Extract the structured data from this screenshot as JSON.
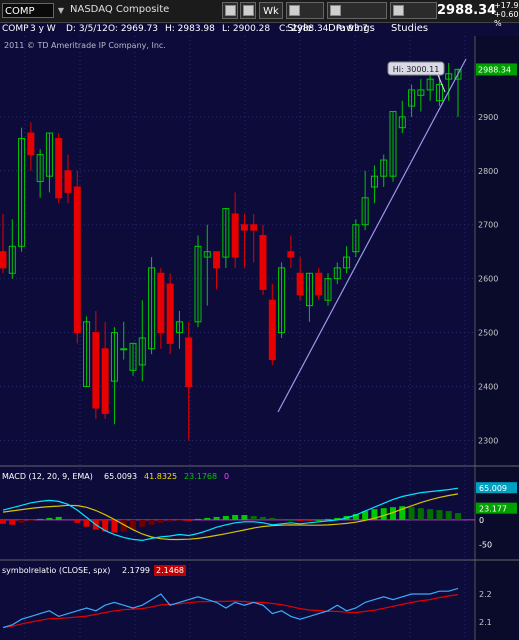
{
  "toolbar": {
    "symbol": "COMP",
    "symbol_name": "NASDAQ Composite",
    "period_button": "Wk",
    "style_button": "Style",
    "drawings_button": "Drawings",
    "studies_button": "Studies",
    "last_price": "2988.34",
    "net_change": "+17.92",
    "pct_change": "+0.60 %"
  },
  "info": {
    "period": "3 y W",
    "date": "D: 3/5/12",
    "open": "O: 2969.73",
    "high": "H: 2983.98",
    "low": "L: 2900.28",
    "close": "C: 2988.34",
    "range": "R: 93.7"
  },
  "copyright": "2011 © TD Ameritrade IP Company, Inc.",
  "hi_label": "Hi: 3000.11",
  "price_flag": "2988.34",
  "colors": {
    "bull": "#00c800",
    "bear": "#e60000",
    "bg": "#0d0b3a",
    "macd_line": "#00e6ff",
    "macd_signal": "#d4c400",
    "ratio_line": "#3aaaff",
    "ratio_ma": "#e60000"
  },
  "price_axis": [
    "2900",
    "2800",
    "2700",
    "2600",
    "2500",
    "2400",
    "2300"
  ],
  "chart_data": [
    {
      "type": "candlestick",
      "ylim": [
        2260,
        3050
      ],
      "candles": [
        {
          "o": 2650,
          "h": 2720,
          "l": 2610,
          "c": 2620
        },
        {
          "o": 2610,
          "h": 2710,
          "l": 2600,
          "c": 2660
        },
        {
          "o": 2660,
          "h": 2880,
          "l": 2650,
          "c": 2860
        },
        {
          "o": 2870,
          "h": 2890,
          "l": 2800,
          "c": 2830
        },
        {
          "o": 2780,
          "h": 2840,
          "l": 2750,
          "c": 2830
        },
        {
          "o": 2790,
          "h": 2870,
          "l": 2760,
          "c": 2870
        },
        {
          "o": 2860,
          "h": 2870,
          "l": 2740,
          "c": 2750
        },
        {
          "o": 2800,
          "h": 2830,
          "l": 2740,
          "c": 2760
        },
        {
          "o": 2770,
          "h": 2800,
          "l": 2480,
          "c": 2500
        },
        {
          "o": 2400,
          "h": 2530,
          "l": 2400,
          "c": 2520
        },
        {
          "o": 2500,
          "h": 2540,
          "l": 2340,
          "c": 2360
        },
        {
          "o": 2470,
          "h": 2520,
          "l": 2340,
          "c": 2350
        },
        {
          "o": 2410,
          "h": 2510,
          "l": 2330,
          "c": 2500
        },
        {
          "o": 2470,
          "h": 2520,
          "l": 2450,
          "c": 2470
        },
        {
          "o": 2430,
          "h": 2480,
          "l": 2420,
          "c": 2480
        },
        {
          "o": 2440,
          "h": 2560,
          "l": 2410,
          "c": 2490
        },
        {
          "o": 2470,
          "h": 2640,
          "l": 2460,
          "c": 2620
        },
        {
          "o": 2610,
          "h": 2620,
          "l": 2470,
          "c": 2500
        },
        {
          "o": 2590,
          "h": 2610,
          "l": 2460,
          "c": 2480
        },
        {
          "o": 2500,
          "h": 2540,
          "l": 2470,
          "c": 2520
        },
        {
          "o": 2490,
          "h": 2520,
          "l": 2300,
          "c": 2400
        },
        {
          "o": 2520,
          "h": 2680,
          "l": 2510,
          "c": 2660
        },
        {
          "o": 2640,
          "h": 2700,
          "l": 2550,
          "c": 2650
        },
        {
          "o": 2650,
          "h": 2650,
          "l": 2580,
          "c": 2620
        },
        {
          "o": 2640,
          "h": 2730,
          "l": 2620,
          "c": 2730
        },
        {
          "o": 2720,
          "h": 2760,
          "l": 2620,
          "c": 2640
        },
        {
          "o": 2700,
          "h": 2720,
          "l": 2620,
          "c": 2690
        },
        {
          "o": 2700,
          "h": 2720,
          "l": 2630,
          "c": 2690
        },
        {
          "o": 2680,
          "h": 2700,
          "l": 2570,
          "c": 2580
        },
        {
          "o": 2560,
          "h": 2590,
          "l": 2440,
          "c": 2450
        },
        {
          "o": 2500,
          "h": 2630,
          "l": 2490,
          "c": 2620
        },
        {
          "o": 2650,
          "h": 2680,
          "l": 2620,
          "c": 2640
        },
        {
          "o": 2610,
          "h": 2640,
          "l": 2560,
          "c": 2570
        },
        {
          "o": 2550,
          "h": 2610,
          "l": 2520,
          "c": 2610
        },
        {
          "o": 2610,
          "h": 2620,
          "l": 2560,
          "c": 2570
        },
        {
          "o": 2560,
          "h": 2610,
          "l": 2550,
          "c": 2600
        },
        {
          "o": 2600,
          "h": 2630,
          "l": 2590,
          "c": 2620
        },
        {
          "o": 2620,
          "h": 2660,
          "l": 2610,
          "c": 2640
        },
        {
          "o": 2650,
          "h": 2710,
          "l": 2640,
          "c": 2700
        },
        {
          "o": 2700,
          "h": 2800,
          "l": 2690,
          "c": 2750
        },
        {
          "o": 2770,
          "h": 2810,
          "l": 2740,
          "c": 2790
        },
        {
          "o": 2790,
          "h": 2830,
          "l": 2770,
          "c": 2820
        },
        {
          "o": 2790,
          "h": 2910,
          "l": 2780,
          "c": 2910
        },
        {
          "o": 2880,
          "h": 2930,
          "l": 2870,
          "c": 2900
        },
        {
          "o": 2920,
          "h": 2960,
          "l": 2900,
          "c": 2950
        },
        {
          "o": 2940,
          "h": 2970,
          "l": 2910,
          "c": 2950
        },
        {
          "o": 2950,
          "h": 2990,
          "l": 2930,
          "c": 2970
        },
        {
          "o": 2930,
          "h": 3000,
          "l": 2920,
          "c": 2960
        },
        {
          "o": 2970,
          "h": 3000,
          "l": 2930,
          "c": 2980
        },
        {
          "o": 2970,
          "h": 2990,
          "l": 2900,
          "c": 2988
        }
      ]
    },
    {
      "type": "line",
      "title": "MACD (12, 20, 9, EMA)",
      "values_text": {
        "macd": "65.0093",
        "signal": "41.8325",
        "diff": "23.1768",
        "extra": "0"
      },
      "axis_labels": [
        "65.009",
        "23.177",
        "0",
        "-50"
      ],
      "ylim": [
        -70,
        90
      ]
    },
    {
      "type": "line",
      "title": "symbolrelatio (CLOSE, spx)",
      "values_text": {
        "ratio": "2.1799",
        "ma": "2.1468"
      },
      "axis_labels": [
        "2.2",
        "2.1"
      ]
    }
  ]
}
